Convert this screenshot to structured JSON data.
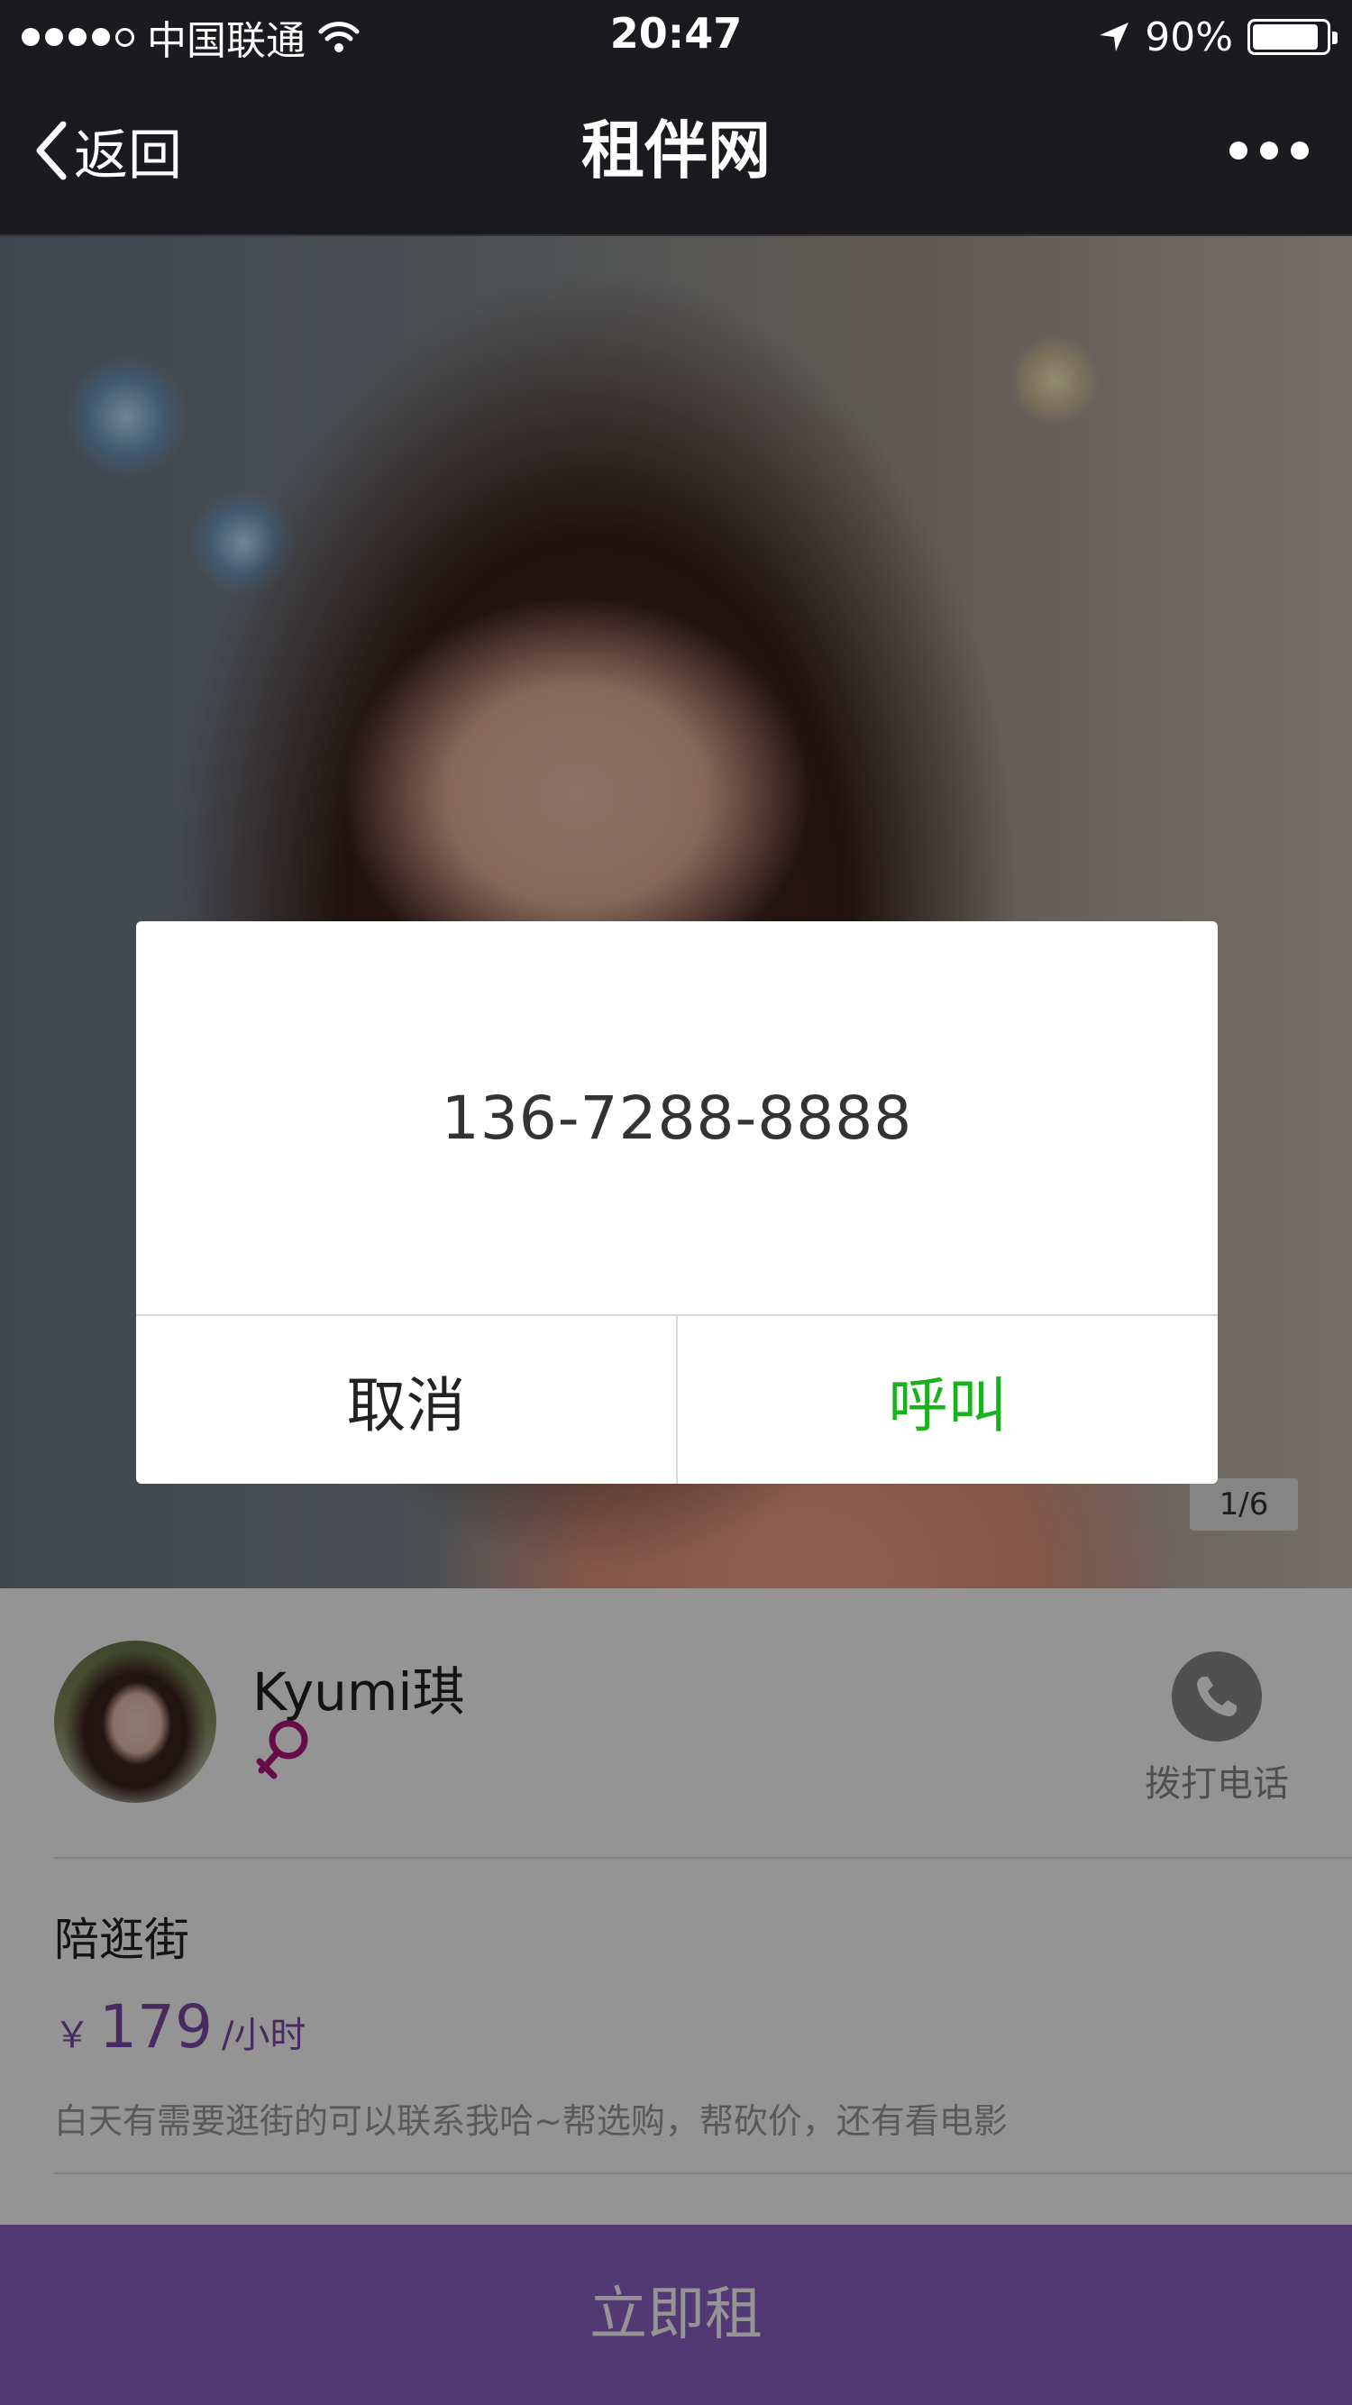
{
  "status_bar": {
    "carrier": "中国联通",
    "time": "20:47",
    "battery_percent": "90%",
    "battery_level": 0.9,
    "icons": [
      "signal-dots",
      "wifi-icon",
      "location-arrow-icon",
      "battery-icon"
    ]
  },
  "nav": {
    "back_label": "返回",
    "title": "租伴网",
    "more_icon": "more-dots-icon"
  },
  "gallery": {
    "counter_current": "1",
    "counter_total": "6"
  },
  "profile": {
    "username": "Kyumi琪",
    "gender_icon": "female-icon",
    "call_label": "拨打电话",
    "service_name": "陪逛街",
    "price_currency": "￥",
    "price_value": "179",
    "price_unit": "/小时",
    "description": "白天有需要逛街的可以联系我哈~帮选购，帮砍价，还有看电影"
  },
  "bottom_bar": {
    "rent_label": "立即租"
  },
  "dialog": {
    "phone_number": "136-7288-8888",
    "cancel_label": "取消",
    "call_label": "呼叫"
  },
  "colors": {
    "nav_background": "#1a1a1f",
    "accent_purple": "#8e63c8",
    "price_purple": "#7a4ba6",
    "female_magenta": "#b0157a",
    "call_green": "#19b21c"
  }
}
